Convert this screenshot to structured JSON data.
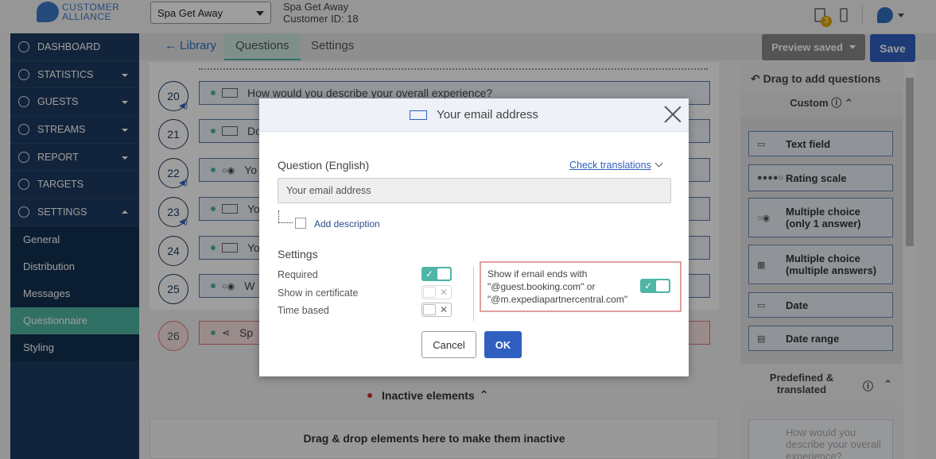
{
  "logo": {
    "line1": "CUSTOMER",
    "line2": "ALLIANCE"
  },
  "hotel_select": {
    "value": "Spa Get Away"
  },
  "hotel_info": {
    "name": "Spa Get Away",
    "customer_id": "Customer ID: 18"
  },
  "header": {
    "doc_badge": "3"
  },
  "sidebar": {
    "items": [
      {
        "label": "DASHBOARD"
      },
      {
        "label": "STATISTICS"
      },
      {
        "label": "GUESTS"
      },
      {
        "label": "STREAMS"
      },
      {
        "label": "REPORT"
      },
      {
        "label": "TARGETS"
      },
      {
        "label": "SETTINGS"
      }
    ],
    "sub_items": [
      {
        "label": "General"
      },
      {
        "label": "Distribution"
      },
      {
        "label": "Messages"
      },
      {
        "label": "Questionnaire"
      },
      {
        "label": "Styling"
      }
    ]
  },
  "tabs": {
    "library": "← Library",
    "questions": "Questions",
    "settings": "Settings"
  },
  "toolbar": {
    "preview_label": "Preview saved",
    "save_label": "Save"
  },
  "questions": [
    {
      "num": "20",
      "text": "How would you describe your overall experience?"
    },
    {
      "num": "21",
      "text": "Do"
    },
    {
      "num": "22",
      "text": "Yo"
    },
    {
      "num": "23",
      "text": "Yo"
    },
    {
      "num": "24",
      "text": "Yo"
    },
    {
      "num": "25",
      "text": "W"
    },
    {
      "num": "26",
      "text": "Sp"
    }
  ],
  "inactive": {
    "label": "Inactive elements",
    "drop_hint": "Drag & drop elements here to make them inactive"
  },
  "palette": {
    "title": "Drag to add questions",
    "custom_label": "Custom",
    "items": [
      {
        "label": "Text field"
      },
      {
        "label": "Rating scale"
      },
      {
        "label": "Multiple choice (only 1 answer)"
      },
      {
        "label": "Multiple choice (multiple answers)"
      },
      {
        "label": "Date"
      },
      {
        "label": "Date range"
      }
    ],
    "predefined_label": "Predefined & translated",
    "predefined_item": "How would you describe your overall experience?"
  },
  "modal": {
    "title": "Your email address",
    "question_label": "Question (English)",
    "check_translations": "Check translations",
    "question_value": "Your email address",
    "add_description": "Add description",
    "settings_heading": "Settings",
    "settings": [
      {
        "label": "Required",
        "on": true
      },
      {
        "label": "Show in certificate",
        "on": false
      },
      {
        "label": "Time based",
        "on": false
      }
    ],
    "email_condition": "Show if email ends with \"@guest.booking.com\" or \"@m.expediapartnercentral.com\"",
    "cancel_label": "Cancel",
    "ok_label": "OK"
  }
}
